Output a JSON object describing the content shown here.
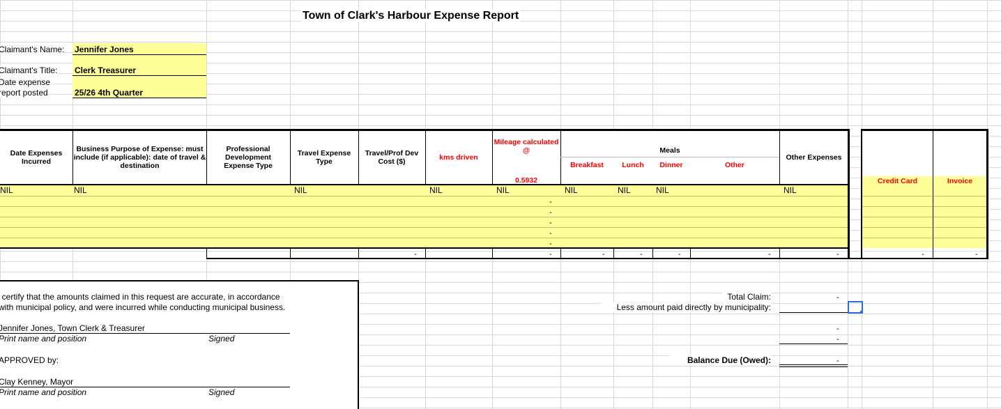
{
  "title": "Town of Clark's Harbour Expense Report",
  "claimant": {
    "name_label": "Claimant's Name:",
    "name_value": "Jennifer Jones",
    "title_label": "Claimant's Title:",
    "title_value": "Clerk Treasurer",
    "date_label_1": "Date expense",
    "date_label_2": "report posted",
    "date_value": "25/26 4th Quarter"
  },
  "table": {
    "headers": {
      "date": "Date Expenses Incurred",
      "purpose": "Business Purpose of Expense: must include (if applicable): date of travel & destination",
      "prof_dev": "Professional Development Expense Type",
      "travel_type": "Travel Expense Type",
      "travel_cost": "Travel/Prof Dev Cost ($)",
      "kms": "kms driven",
      "mileage": "Mileage calculated @",
      "mileage_rate": "0.5932",
      "meals": "Meals",
      "breakfast": "Breakfast",
      "lunch": "Lunch",
      "dinner": "Dinner",
      "other": "Other",
      "other_expenses": "Other Expenses",
      "credit_card": "Credit Card",
      "invoice": "Invoice"
    },
    "first_row": {
      "date": "NIL",
      "purpose": "NIL",
      "travel_type": "NIL",
      "kms": "NIL",
      "mileage": "NIL",
      "breakfast": "NIL",
      "lunch": "NIL",
      "dinner": "NIL",
      "other_expenses": "NIL"
    },
    "mileage_dashes": [
      "-",
      "-",
      "-",
      "-",
      "-"
    ],
    "totals_dash": "-"
  },
  "certification": {
    "line1": "I certify that the amounts claimed in this request are accurate, in accordance",
    "line2": "with municipal policy, and were incurred while conducting municipal business.",
    "claimant_name": "Jennifer Jones, Town Clerk & Treasurer",
    "print_label": "Print name and position",
    "signed_label": "Signed",
    "approved_label": "APPROVED by:",
    "approver_name": "Clay Kenney, Mayor",
    "print_label_2": "Print name and position",
    "signed_label_2": "Signed"
  },
  "summary": {
    "total_claim_label": "Total Claim:",
    "total_claim_value": "-",
    "less_paid_label": "Less amount paid directly by municipality:",
    "dash_1": "-",
    "dash_2": "-",
    "balance_label": "Balance Due (Owed):",
    "balance_value": "-"
  },
  "colors": {
    "input_fill": "#ffff99",
    "accent_red": "#ff0000",
    "gridline": "#d9d9d9"
  }
}
